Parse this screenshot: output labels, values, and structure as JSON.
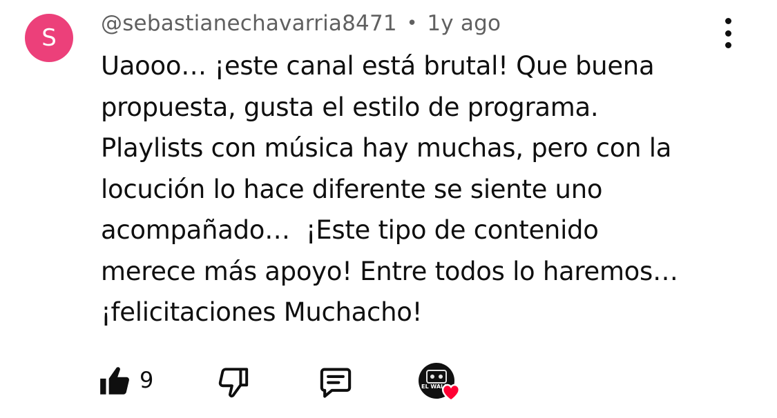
{
  "comment": {
    "avatar_letter": "S",
    "avatar_color": "#ec407a",
    "author": "@sebastianechavarria8471",
    "separator": "•",
    "time": "1y ago",
    "lines": [
      "Uaooo… ¡este canal está brutal! Que buena",
      "propuesta, gusta el estilo de programa.",
      "Playlists con música hay muchas, pero con la",
      "locución lo hace diferente se siente uno",
      "acompañado…  ¡Este tipo de contenido",
      "merece más apoyo! Entre todos lo haremos…",
      "¡felicitaciones Muchacho!"
    ],
    "like_count": "9",
    "creator_badge_label": "EL WALK",
    "heart_color": "#ff0033"
  },
  "icons": {
    "more": "more-vertical-icon",
    "like": "thumbs-up-icon",
    "dislike": "thumbs-down-icon",
    "reply": "reply-comment-icon",
    "creator_heart": "creator-heart-icon"
  }
}
